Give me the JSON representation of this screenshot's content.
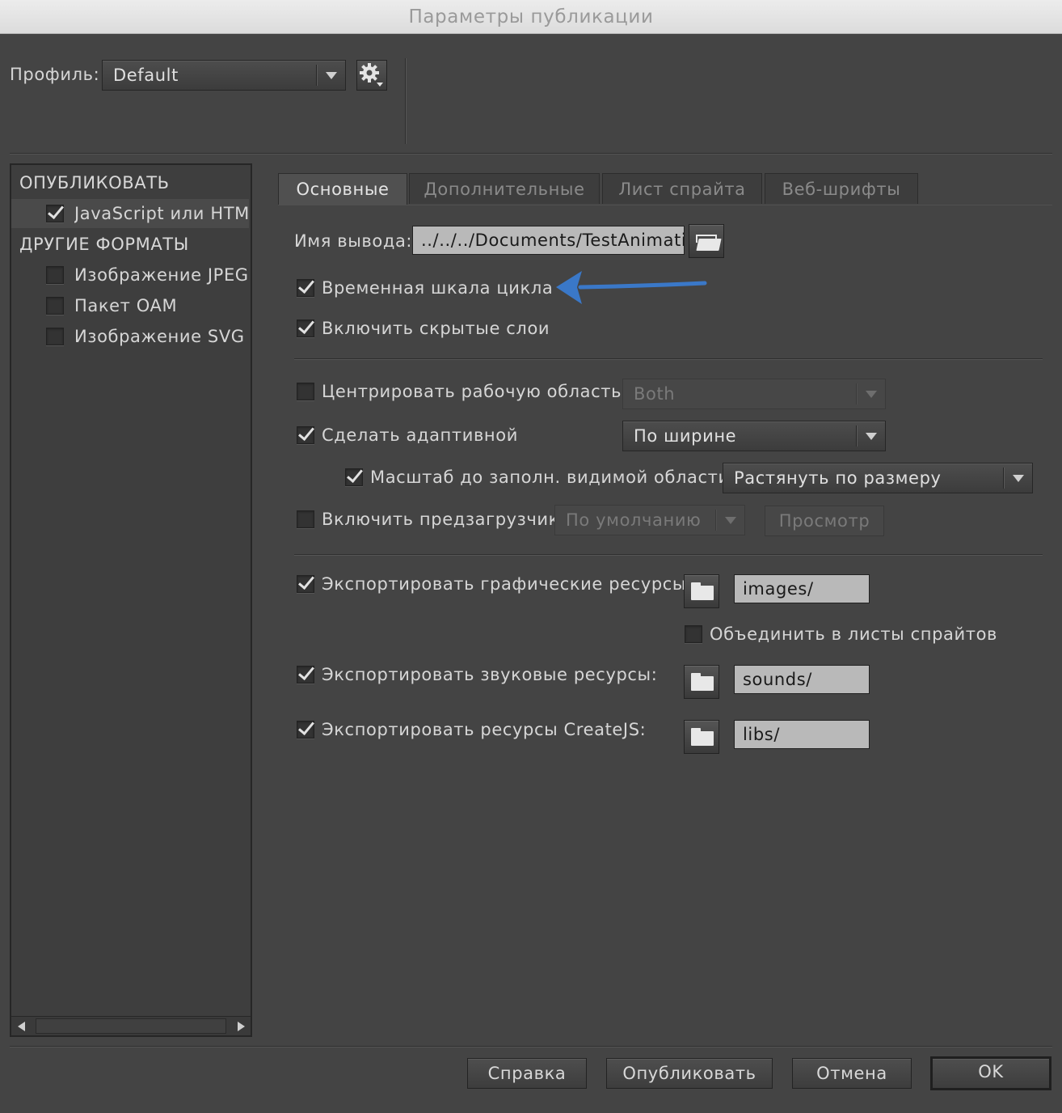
{
  "window": {
    "title": "Параметры публикации"
  },
  "header": {
    "profile_label": "Профиль:",
    "profile_value": "Default"
  },
  "sidebar": {
    "publish_heading": "ОПУБЛИКОВАТЬ",
    "publish_items": [
      {
        "label": "JavaScript или HTML",
        "checked": true
      }
    ],
    "other_heading": "ДРУГИЕ ФОРМАТЫ",
    "other_items": [
      {
        "label": "Изображение JPEG",
        "checked": false
      },
      {
        "label": "Пакет OAM",
        "checked": false
      },
      {
        "label": "Изображение SVG",
        "checked": false
      }
    ]
  },
  "tabs": [
    {
      "label": "Основные",
      "active": true
    },
    {
      "label": "Дополнительные",
      "active": false
    },
    {
      "label": "Лист спрайта",
      "active": false
    },
    {
      "label": "Веб-шрифты",
      "active": false
    }
  ],
  "basic": {
    "output_label": "Имя вывода:",
    "output_value": "../../../Documents/TestAnimation",
    "loop_timeline": {
      "label": "Временная шкала цикла",
      "checked": true
    },
    "include_hidden": {
      "label": "Включить скрытые слои",
      "checked": true
    },
    "center_stage": {
      "label": "Центрировать рабочую область",
      "checked": false,
      "option": "Both"
    },
    "responsive": {
      "label": "Сделать адаптивной",
      "checked": true,
      "option": "По ширине"
    },
    "scale": {
      "label": "Масштаб до заполн. видимой области",
      "checked": true,
      "option": "Растянуть по размеру"
    },
    "preloader": {
      "label": "Включить предзагрузчик",
      "checked": false,
      "option": "По умолчанию",
      "preview_label": "Просмотр"
    },
    "export_images": {
      "label": "Экспортировать графические ресурсы:",
      "checked": true,
      "path": "images/"
    },
    "combine_sprites": {
      "label": "Объединить в листы спрайтов",
      "checked": false
    },
    "export_sounds": {
      "label": "Экспортировать звуковые ресурсы:",
      "checked": true,
      "path": "sounds/"
    },
    "export_createjs": {
      "label": "Экспортировать ресурсы CreateJS:",
      "checked": true,
      "path": "libs/"
    }
  },
  "footer": {
    "help": "Справка",
    "publish": "Опубликовать",
    "cancel": "Отмена",
    "ok": "OK"
  },
  "colors": {
    "background": "#444444",
    "annotation_arrow": "#3a78c8"
  }
}
